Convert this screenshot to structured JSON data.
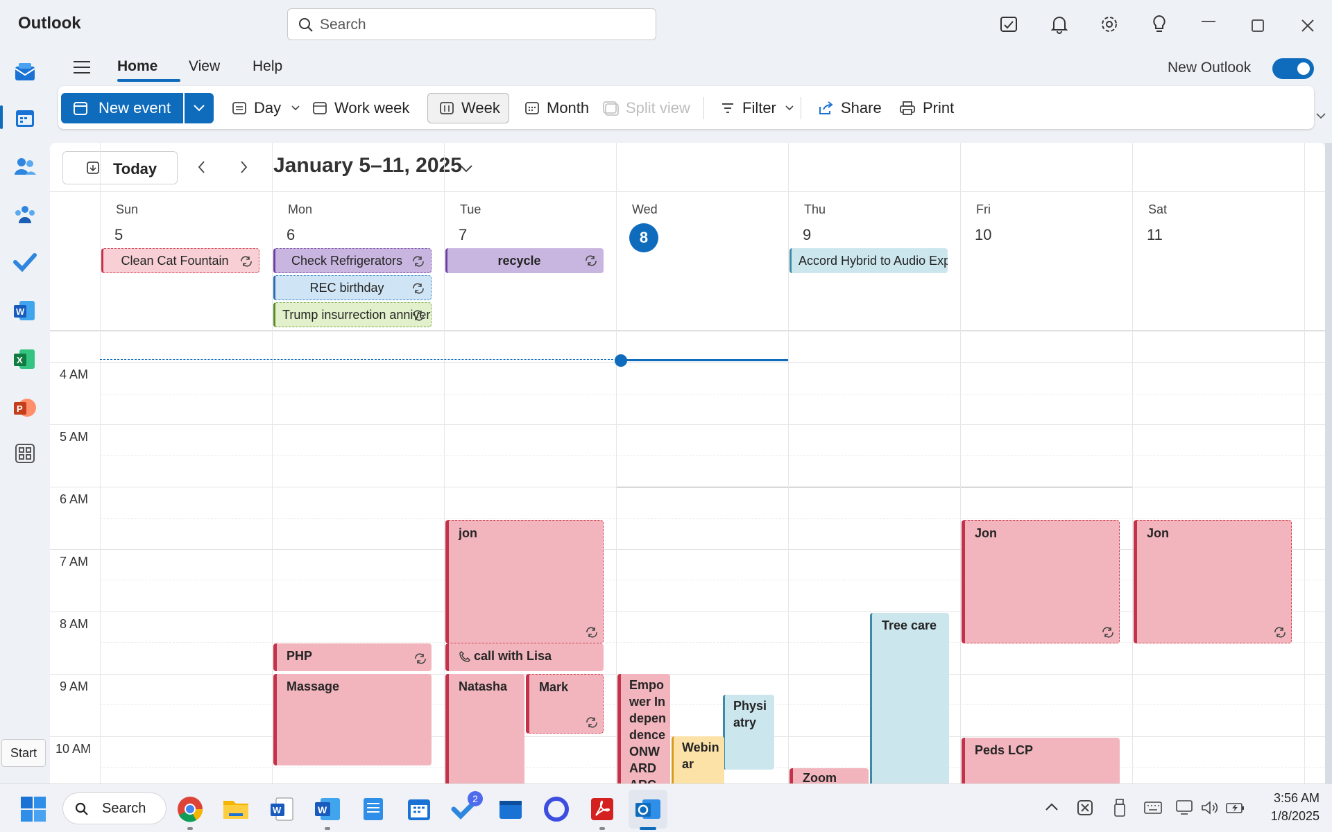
{
  "titlebar": {
    "app_title": "Outlook",
    "search_placeholder": "Search"
  },
  "tabs": [
    "Home",
    "View",
    "Help"
  ],
  "new_outlook_label": "New Outlook",
  "new_outlook_toggle": "on",
  "ribbon": {
    "new_event": "New event",
    "day": "Day",
    "work_week": "Work week",
    "week": "Week",
    "month": "Month",
    "split_view": "Split view",
    "filter": "Filter",
    "share": "Share",
    "print": "Print"
  },
  "nav": {
    "today": "Today",
    "range": "January 5–11, 2025"
  },
  "days": [
    {
      "name": "Sun",
      "num": "5"
    },
    {
      "name": "Mon",
      "num": "6"
    },
    {
      "name": "Tue",
      "num": "7"
    },
    {
      "name": "Wed",
      "num": "8"
    },
    {
      "name": "Thu",
      "num": "9"
    },
    {
      "name": "Fri",
      "num": "10"
    },
    {
      "name": "Sat",
      "num": "11"
    }
  ],
  "allday_events": [
    {
      "title": "Clean Cat Fountain"
    },
    {
      "title": "Check Refrigerators"
    },
    {
      "title": "REC birthday"
    },
    {
      "title": "Trump insurrection anniversary"
    },
    {
      "title": "recycle"
    },
    {
      "title": "Accord Hybrid to Audio Express"
    }
  ],
  "time_labels": [
    "4 AM",
    "5 AM",
    "6 AM",
    "7 AM",
    "8 AM",
    "9 AM",
    "10 AM"
  ],
  "events": [
    {
      "title": "jon"
    },
    {
      "title": "Jon"
    },
    {
      "title": "Jon"
    },
    {
      "title": "Tree care"
    },
    {
      "title": "PHP"
    },
    {
      "title": "call with Lisa"
    },
    {
      "title": "Massage"
    },
    {
      "title": "Natasha"
    },
    {
      "title": "Mark"
    },
    {
      "title": "Empower Independence ONWARD ARC-EX",
      "extra": "http"
    },
    {
      "title": "Physiatry"
    },
    {
      "title": "Webinar"
    },
    {
      "title": "Zoom"
    },
    {
      "title": "Peds LCP"
    }
  ],
  "tooltip": "Start",
  "taskbar": {
    "search": "Search",
    "badge": "2",
    "time": "3:56 AM",
    "date": "1/8/2025"
  },
  "colors": {
    "accent": "#0f6cbd",
    "event_pink": "#f2b5bd",
    "event_red_border": "#c4314b",
    "allday_purple": "#c9b6e0",
    "allday_blue": "#cfe4f4",
    "allday_green": "#e2f0cb",
    "event_teal": "#cce6ee",
    "event_orange": "#fde2a8"
  }
}
